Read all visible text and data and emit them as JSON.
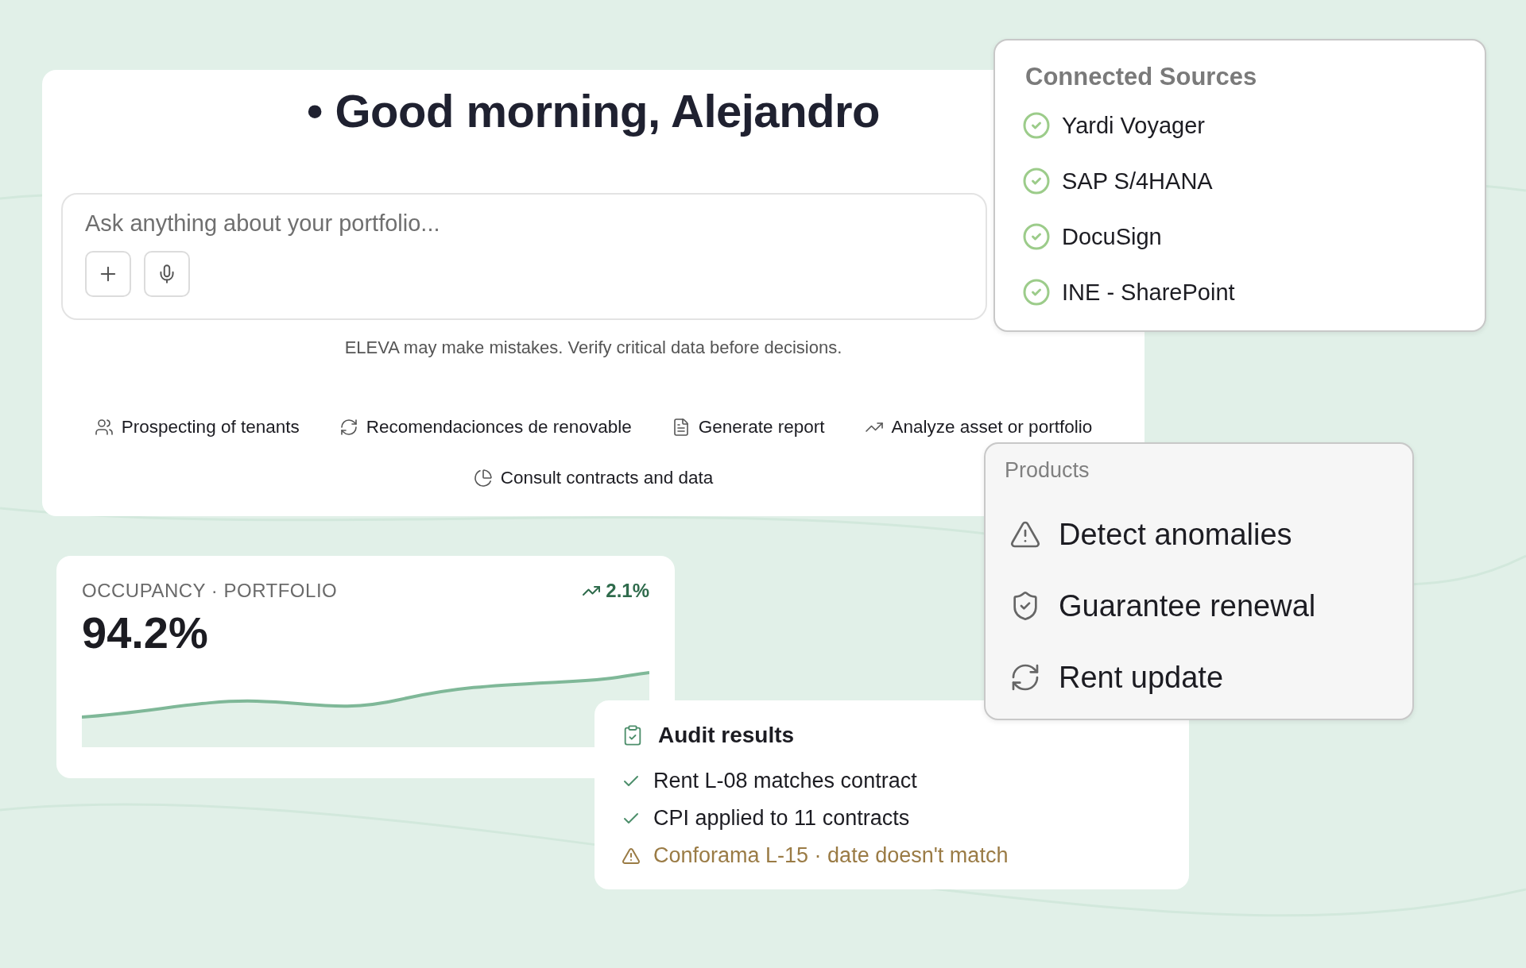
{
  "assistant": {
    "greeting": "• Good morning, Alejandro",
    "prompt": {
      "placeholder": "Ask anything about your portfolio..."
    },
    "disclaimer": "ELEVA may make mistakes. Verify critical data before decisions.",
    "actions": [
      {
        "kind": "people",
        "label": "Prospecting of tenants"
      },
      {
        "kind": "refresh",
        "label": "Recomendacionces de renovable"
      },
      {
        "kind": "document",
        "label": "Generate report"
      },
      {
        "kind": "trend",
        "label": "Analyze asset or portfolio"
      },
      {
        "kind": "pie",
        "label": "Consult contracts and data"
      }
    ]
  },
  "connected_sources": {
    "title": "Connected Sources",
    "items": [
      {
        "label": "Yardi Voyager"
      },
      {
        "label": "SAP S/4HANA"
      },
      {
        "label": "DocuSign"
      },
      {
        "label": "INE - SharePoint"
      }
    ]
  },
  "products": {
    "title": "Products",
    "items": [
      {
        "kind": "warning",
        "label": "Detect anomalies"
      },
      {
        "kind": "shield",
        "label": "Guarantee renewal"
      },
      {
        "kind": "refresh",
        "label": "Rent update"
      }
    ]
  },
  "occupancy": {
    "label": "OCCUPANCY · PORTFOLIO",
    "value": "94.2%",
    "change": "2.1%"
  },
  "audit": {
    "title": "Audit results",
    "items": [
      {
        "kind": "ok",
        "text": "Rent L-08 matches contract"
      },
      {
        "kind": "ok",
        "text": "CPI applied to 11 contracts"
      },
      {
        "kind": "warning",
        "text": "Conforama L-15 · date doesn't match"
      }
    ]
  }
}
